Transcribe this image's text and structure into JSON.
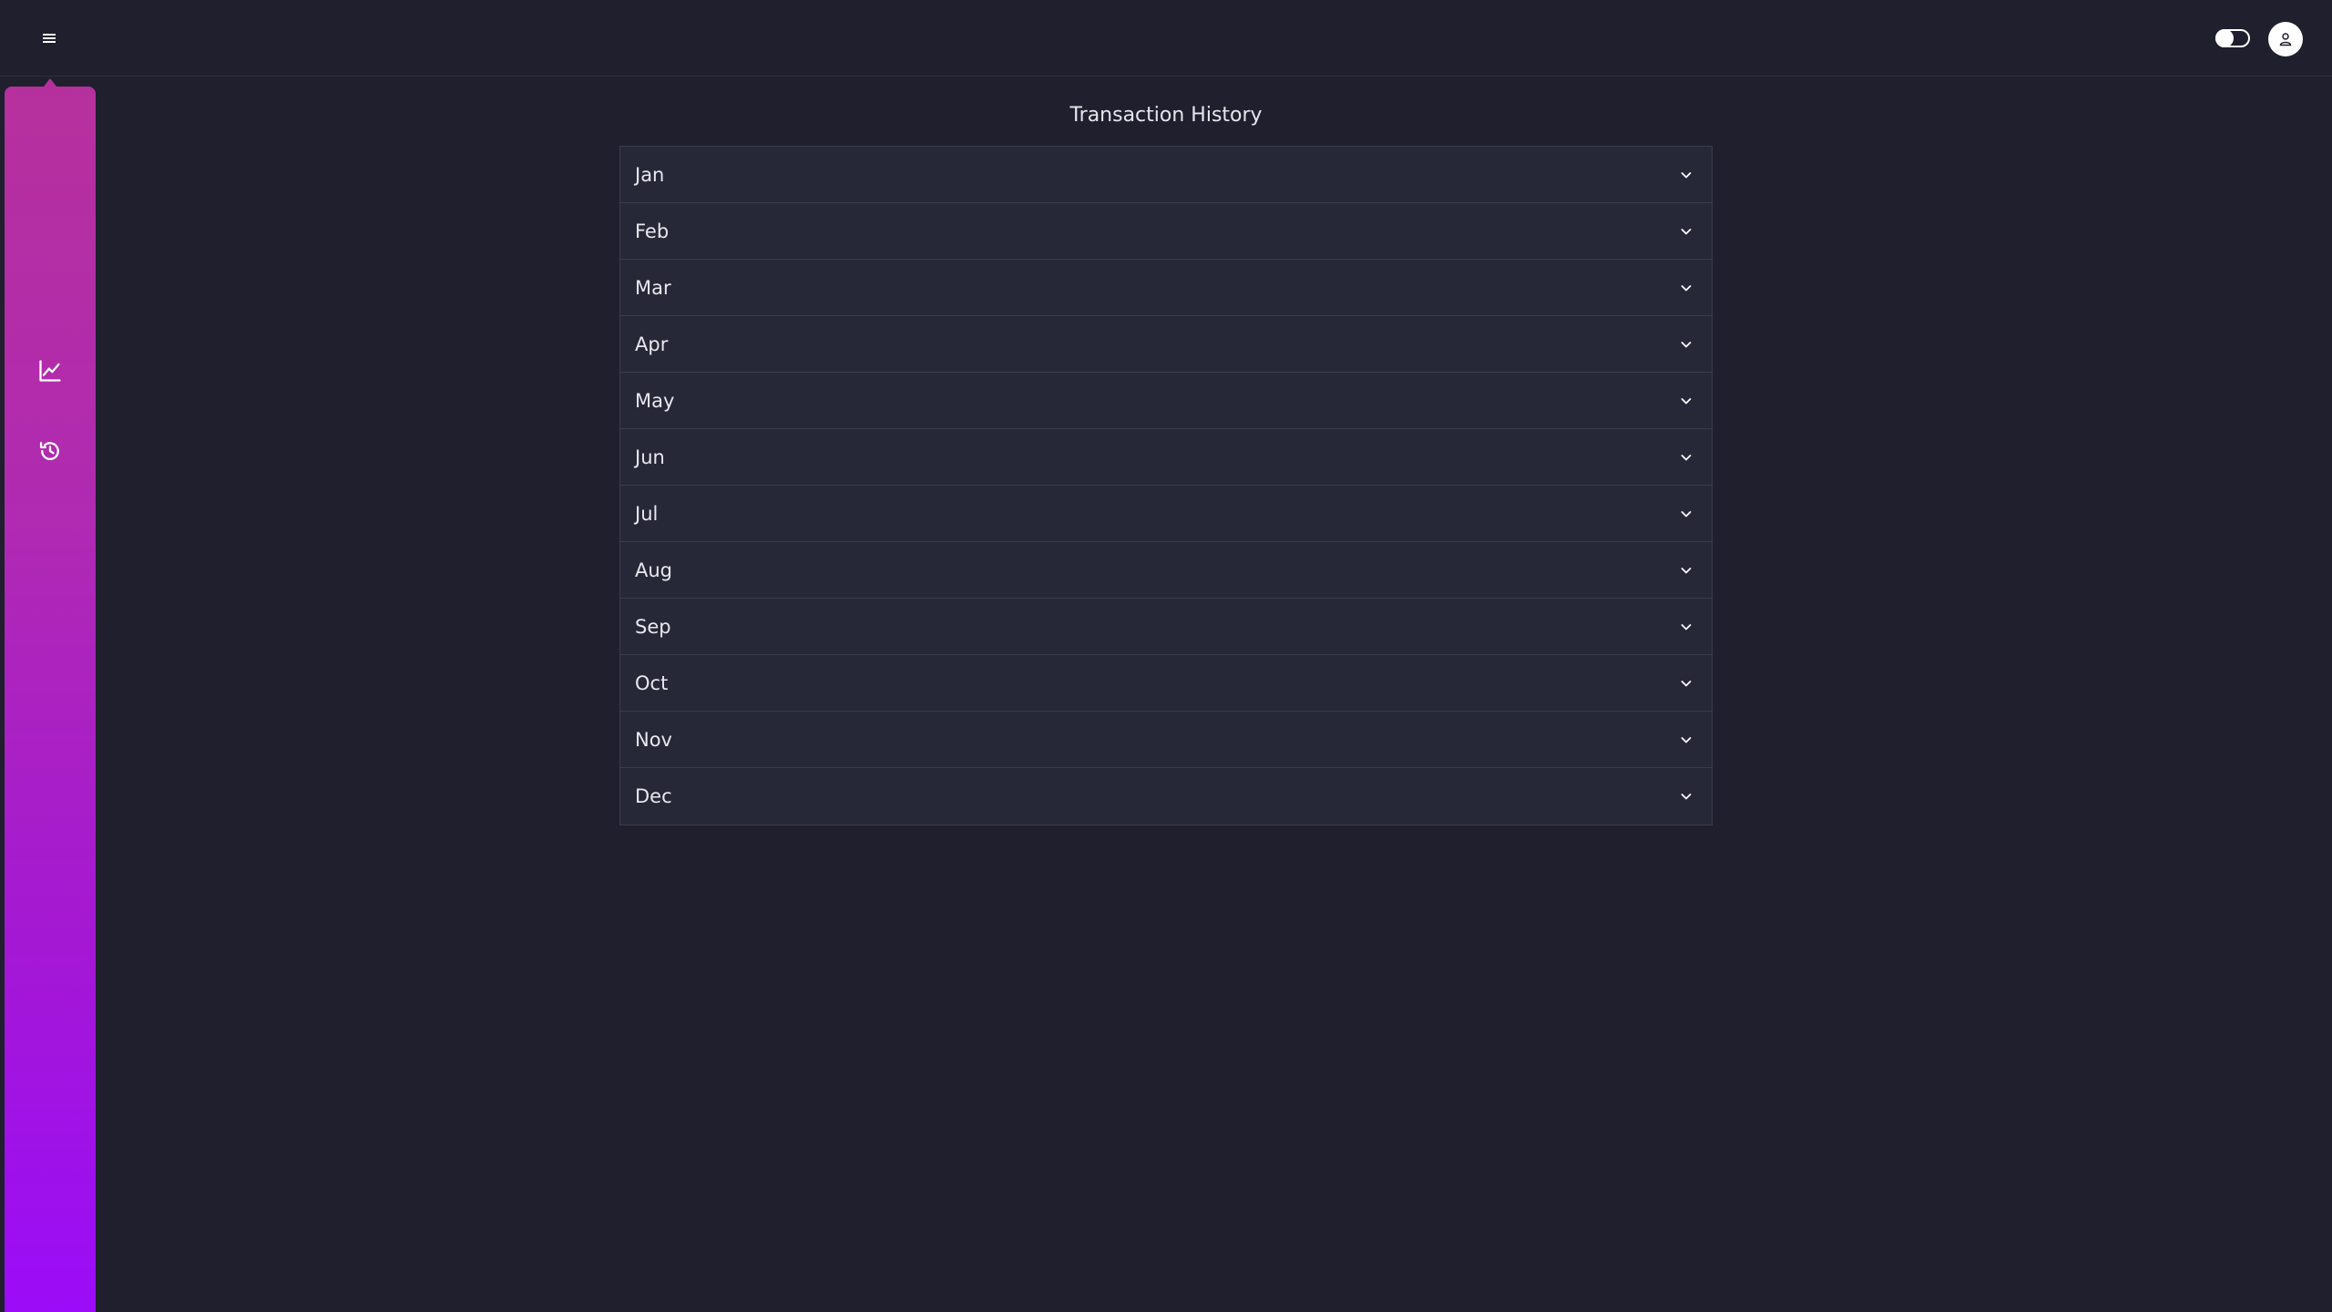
{
  "header": {
    "menu_icon": "hamburger-icon",
    "theme_toggle_icon": "toggle-icon",
    "avatar_icon": "user-icon"
  },
  "sidebar": {
    "items": [
      {
        "icon": "line-chart-icon"
      },
      {
        "icon": "history-icon"
      }
    ],
    "gradient": [
      "#b6309d",
      "#9b0cf8"
    ]
  },
  "main": {
    "title": "Transaction History",
    "months": [
      {
        "label": "Jan"
      },
      {
        "label": "Feb"
      },
      {
        "label": "Mar"
      },
      {
        "label": "Apr"
      },
      {
        "label": "May"
      },
      {
        "label": "Jun"
      },
      {
        "label": "Jul"
      },
      {
        "label": "Aug"
      },
      {
        "label": "Sep"
      },
      {
        "label": "Oct"
      },
      {
        "label": "Nov"
      },
      {
        "label": "Dec"
      }
    ]
  },
  "colors": {
    "background": "#1f1f2e",
    "panel": "#262838",
    "border": "#3a3c4c",
    "text": "#e8e8ee"
  }
}
